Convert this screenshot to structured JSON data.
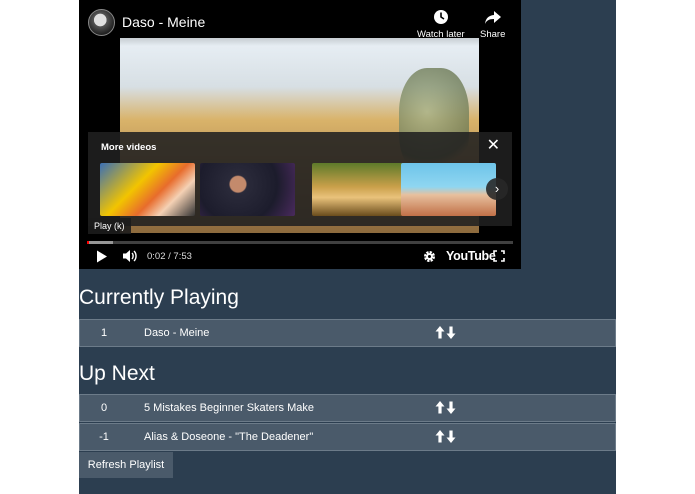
{
  "player": {
    "video_title": "Daso - Meine",
    "watch_later_label": "Watch later",
    "share_label": "Share",
    "more_videos_label": "More videos",
    "tooltip": "Play (k)",
    "time_display": "0:02 / 7:53",
    "brand": "YouTube",
    "progress_played_fraction": 0.004,
    "progress_loaded_fraction": 0.06,
    "icons": [
      "channel-avatar",
      "clock-icon",
      "share-icon",
      "close-icon",
      "chevron-right-icon",
      "play-icon",
      "volume-icon",
      "gear-icon",
      "fullscreen-icon"
    ]
  },
  "currently_playing": {
    "heading": "Currently Playing",
    "rows": [
      {
        "num": "1",
        "title": "Daso - Meine"
      }
    ]
  },
  "up_next": {
    "heading": "Up Next",
    "rows": [
      {
        "num": "0",
        "title": "5 Mistakes Beginner Skaters Make"
      },
      {
        "num": "-1",
        "title": "Alias & Doseone - \"The Deadener\""
      }
    ]
  },
  "refresh_label": "Refresh Playlist",
  "colors": {
    "panel": "#2c3e50",
    "row": "#4a5a6a",
    "progress": "#ff0000"
  }
}
